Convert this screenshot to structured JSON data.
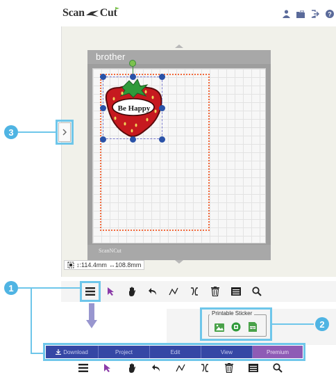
{
  "header": {
    "logo_scan": "Scan",
    "logo_cut": "Cut",
    "icons": [
      "user-icon",
      "folder-icon",
      "logout-icon",
      "help-icon"
    ]
  },
  "mat": {
    "brand": "brother",
    "bottom_logo": "ScanNCut"
  },
  "canvas": {
    "sticker_text": "Be Happy"
  },
  "size_readout": {
    "height_label": "↕:114.4mm",
    "width_label": "↔108.8mm"
  },
  "callouts": {
    "one": "1",
    "two": "2",
    "three": "3"
  },
  "toolbar": {
    "tools": [
      "menu-icon",
      "select-arrow-icon",
      "hand-icon",
      "undo-icon",
      "path-icon",
      "flip-icon",
      "trash-icon",
      "layers-icon",
      "zoom-icon"
    ]
  },
  "sticker_panel": {
    "title": "Printable Sticker"
  },
  "menubar": {
    "items": [
      "Download",
      "Project",
      "Edit",
      "View",
      "Premium"
    ]
  },
  "colors": {
    "accent": "#4fb4e3",
    "menu_bg": "#3547a5",
    "premium_bg": "#8e5bb5",
    "cut_line": "#f26a3c",
    "handle": "#2a52a8"
  }
}
